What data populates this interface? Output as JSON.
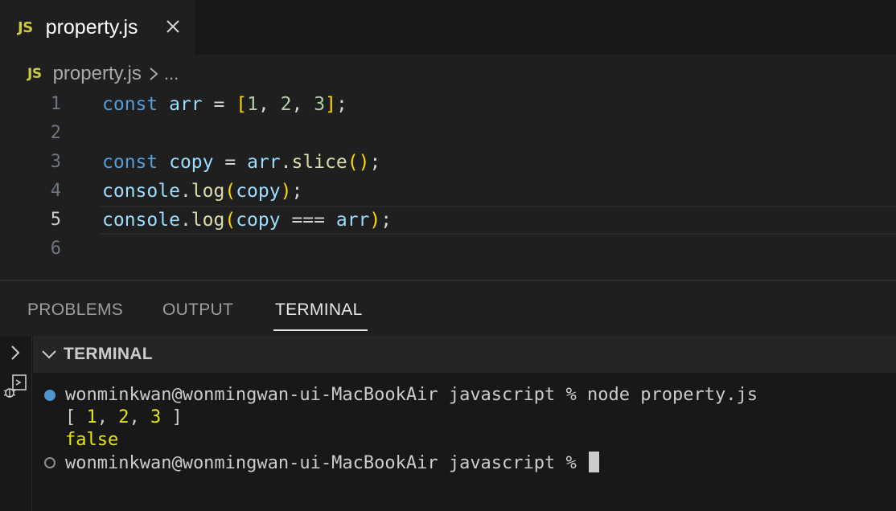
{
  "tab": {
    "badge": "JS",
    "title": "property.js",
    "close_icon": "close-icon"
  },
  "breadcrumb": {
    "badge": "JS",
    "file": "property.js",
    "separator_icon": "chevron-right-icon",
    "more": "..."
  },
  "editor": {
    "current_line": 5,
    "lines": [
      {
        "number": "1",
        "text": "const arr = [1, 2, 3];"
      },
      {
        "number": "2",
        "text": ""
      },
      {
        "number": "3",
        "text": "const copy = arr.slice();"
      },
      {
        "number": "4",
        "text": "console.log(copy);"
      },
      {
        "number": "5",
        "text": "console.log(copy === arr);"
      },
      {
        "number": "6",
        "text": ""
      }
    ]
  },
  "panel": {
    "tabs": [
      {
        "label": "PROBLEMS",
        "active": false
      },
      {
        "label": "OUTPUT",
        "active": false
      },
      {
        "label": "TERMINAL",
        "active": true
      }
    ],
    "section_title": "TERMINAL",
    "section_icon": "chevron-down-icon",
    "side_icons": [
      "chevron-right-icon",
      "debug-console-icon"
    ]
  },
  "terminal": {
    "lines": [
      {
        "marker": "filled",
        "prompt": "wonminkwan@wonmingwan-ui-MacBookAir javascript % ",
        "command": "node property.js"
      },
      {
        "marker": "none",
        "output": "[ 1, 2, 3 ]"
      },
      {
        "marker": "none",
        "output": "false"
      },
      {
        "marker": "hollow",
        "prompt": "wonminkwan@wonmingwan-ui-MacBookAir javascript % ",
        "command": ""
      }
    ]
  },
  "colors": {
    "keyword": "#569cd6",
    "variable": "#9cdcfe",
    "number": "#b5cea8",
    "function": "#dcdcaa",
    "bracket": "#ffd700",
    "js_badge": "#cbcb41",
    "terminal_yellow": "#e5e510",
    "terminal_dot": "#4e94ce"
  }
}
